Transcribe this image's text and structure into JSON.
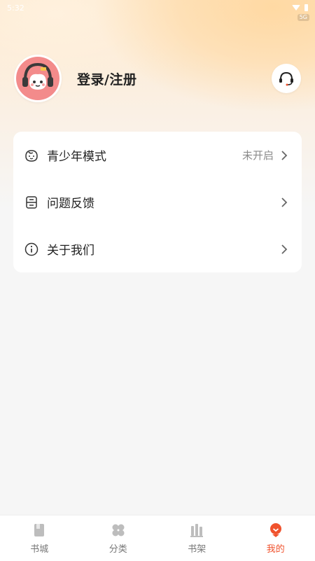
{
  "status_bar": {
    "time": "5:32",
    "badge": "5G"
  },
  "profile": {
    "login_label": "登录/注册"
  },
  "menu": {
    "items": [
      {
        "label": "青少年模式",
        "value": "未开启",
        "icon": "face-icon"
      },
      {
        "label": "问题反馈",
        "value": "",
        "icon": "feedback-icon"
      },
      {
        "label": "关于我们",
        "value": "",
        "icon": "info-icon"
      }
    ]
  },
  "tabs": [
    {
      "label": "书城",
      "icon": "book-icon",
      "active": false
    },
    {
      "label": "分类",
      "icon": "category-icon",
      "active": false
    },
    {
      "label": "书架",
      "icon": "bookshelf-icon",
      "active": false
    },
    {
      "label": "我的",
      "icon": "profile-icon",
      "active": true
    }
  ],
  "colors": {
    "accent": "#f0522d",
    "background": "#f6f6f6",
    "card": "#ffffff"
  }
}
